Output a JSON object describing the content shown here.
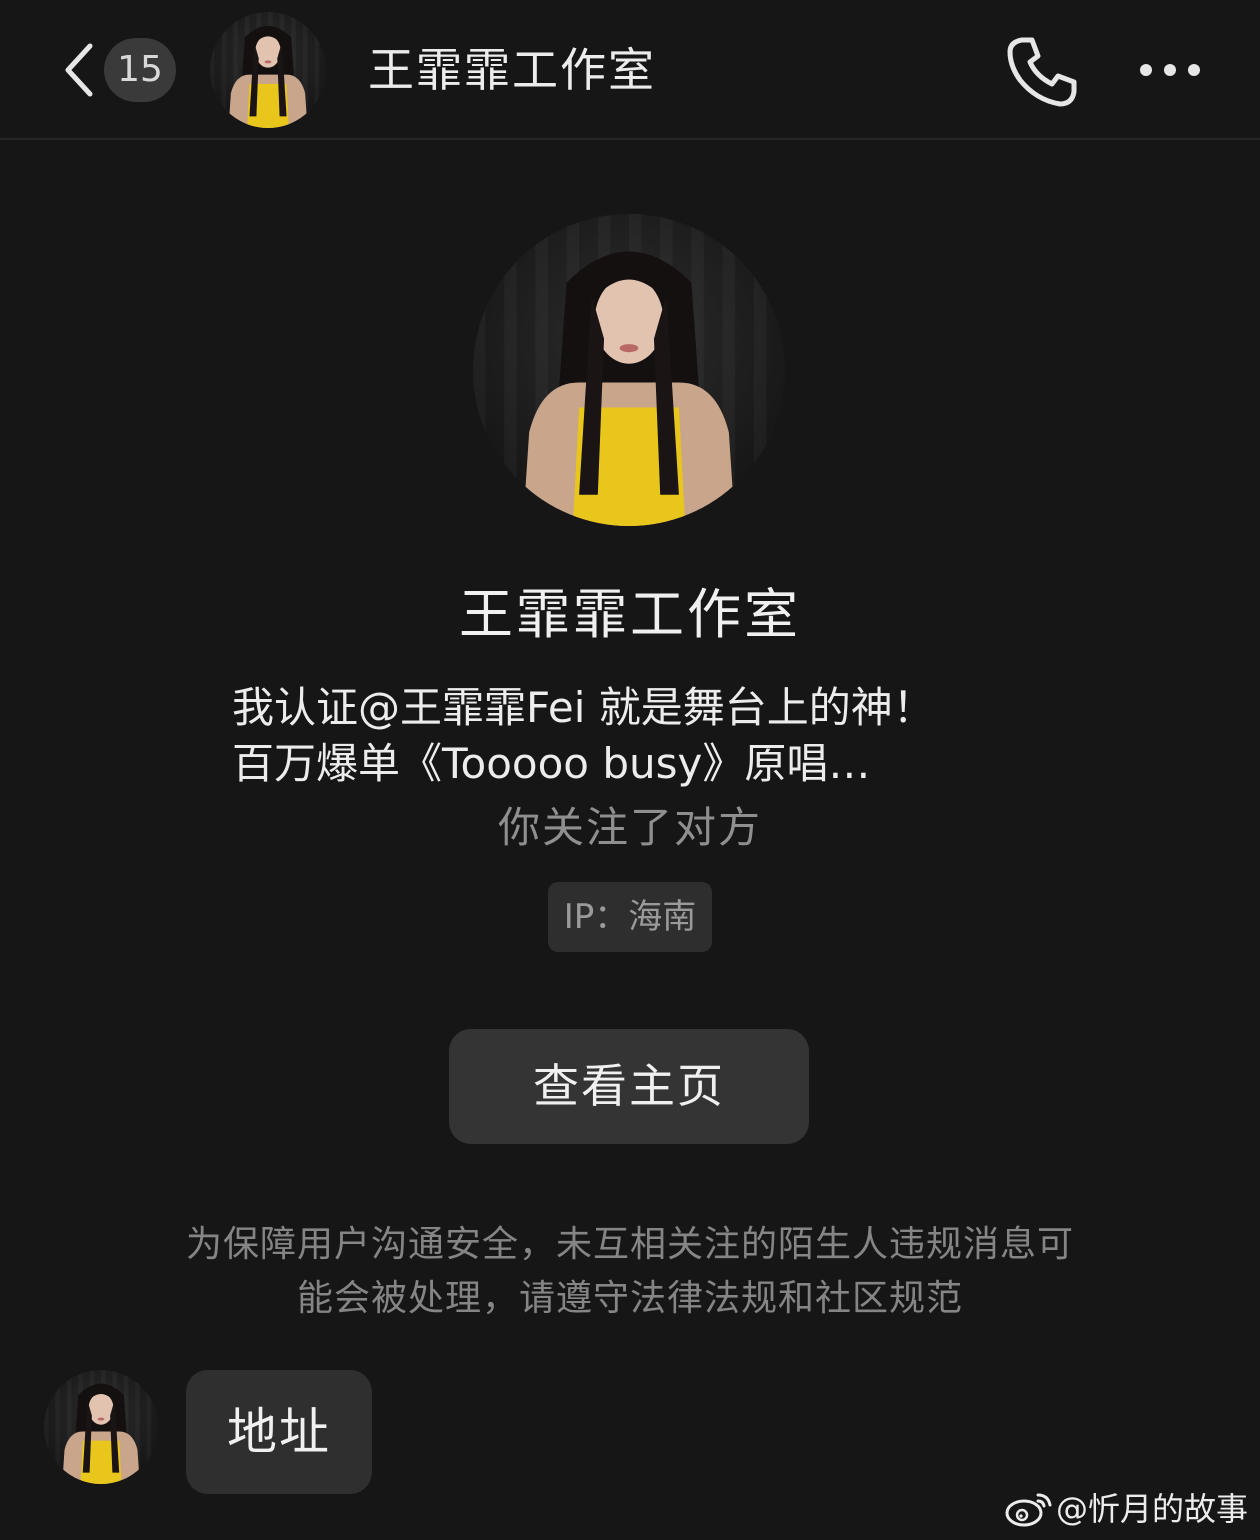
{
  "header": {
    "unread_count": "15",
    "title": "王霏霏工作室"
  },
  "profile": {
    "name": "王霏霏工作室",
    "bio_line1": "我认证@王霏霏Fei 就是舞台上的神！",
    "bio_line2": "百万爆单《Tooooo busy》原唱…",
    "follow_status": "你关注了对方",
    "ip_label": "IP：海南",
    "view_home_label": "查看主页"
  },
  "notice": {
    "line1": "为保障用户沟通安全，未互相关注的陌生人违规消息可",
    "line2": "能会被处理，请遵守法律法规和社区规范"
  },
  "messages": [
    {
      "sender": "contact",
      "text": "地址"
    }
  ],
  "watermark": {
    "text": "@忻月的故事"
  },
  "icons": {
    "back": "chevron-left-icon",
    "call": "phone-icon",
    "more": "ellipsis-icon",
    "watermark_logo": "weibo-logo-icon"
  },
  "colors": {
    "background": "#161616",
    "bubble": "#2f2f2f",
    "button": "#343434",
    "muted_text": "#8f8f8f",
    "accent_yellow": "#e8c61c"
  }
}
